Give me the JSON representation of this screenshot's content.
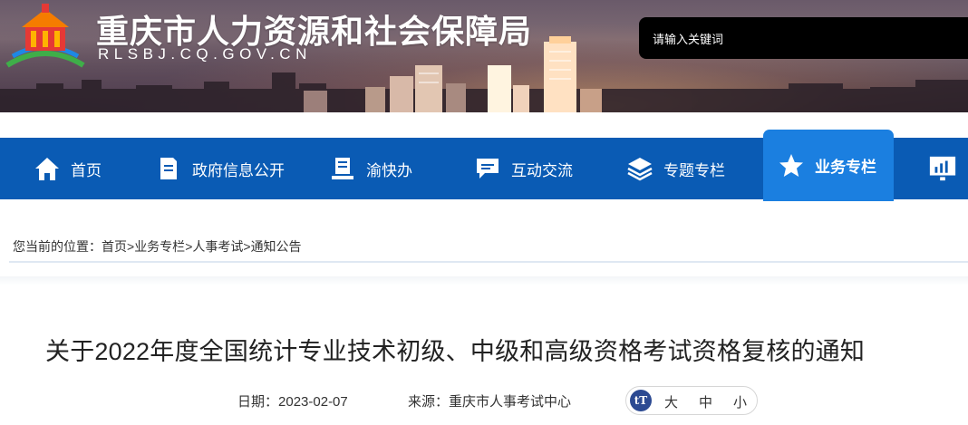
{
  "header": {
    "site_title": "重庆市人力资源和社会保障局",
    "site_domain": "RLSBJ.CQ.GOV.CN",
    "search_placeholder": "请输入关键词"
  },
  "nav": {
    "items": [
      {
        "label": "首页",
        "icon": "home-icon"
      },
      {
        "label": "政府信息公开",
        "icon": "document-icon"
      },
      {
        "label": "渝快办",
        "icon": "service-book-icon"
      },
      {
        "label": "互动交流",
        "icon": "chat-icon"
      },
      {
        "label": "专题专栏",
        "icon": "layers-icon"
      },
      {
        "label": "业务专栏",
        "icon": "star-icon",
        "active": true
      },
      {
        "label": "",
        "icon": "data-chart-icon"
      }
    ]
  },
  "breadcrumb": {
    "prefix": "您当前的位置：",
    "items": [
      "首页",
      "业务专栏",
      "人事考试",
      "通知公告"
    ],
    "separator": ">"
  },
  "article": {
    "title": "关于2022年度全国统计专业技术初级、中级和高级资格考试资格复核的通知",
    "date_label": "日期：",
    "date": "2023-02-07",
    "source_label": "来源：",
    "source": "重庆市人事考试中心",
    "font_size": {
      "icon": "tT",
      "large": "大",
      "medium": "中",
      "small": "小"
    }
  },
  "colors": {
    "nav_bg": "#0a5bb4",
    "nav_active": "#1b7fe0",
    "fontsize_icon": "#2c4a92"
  }
}
